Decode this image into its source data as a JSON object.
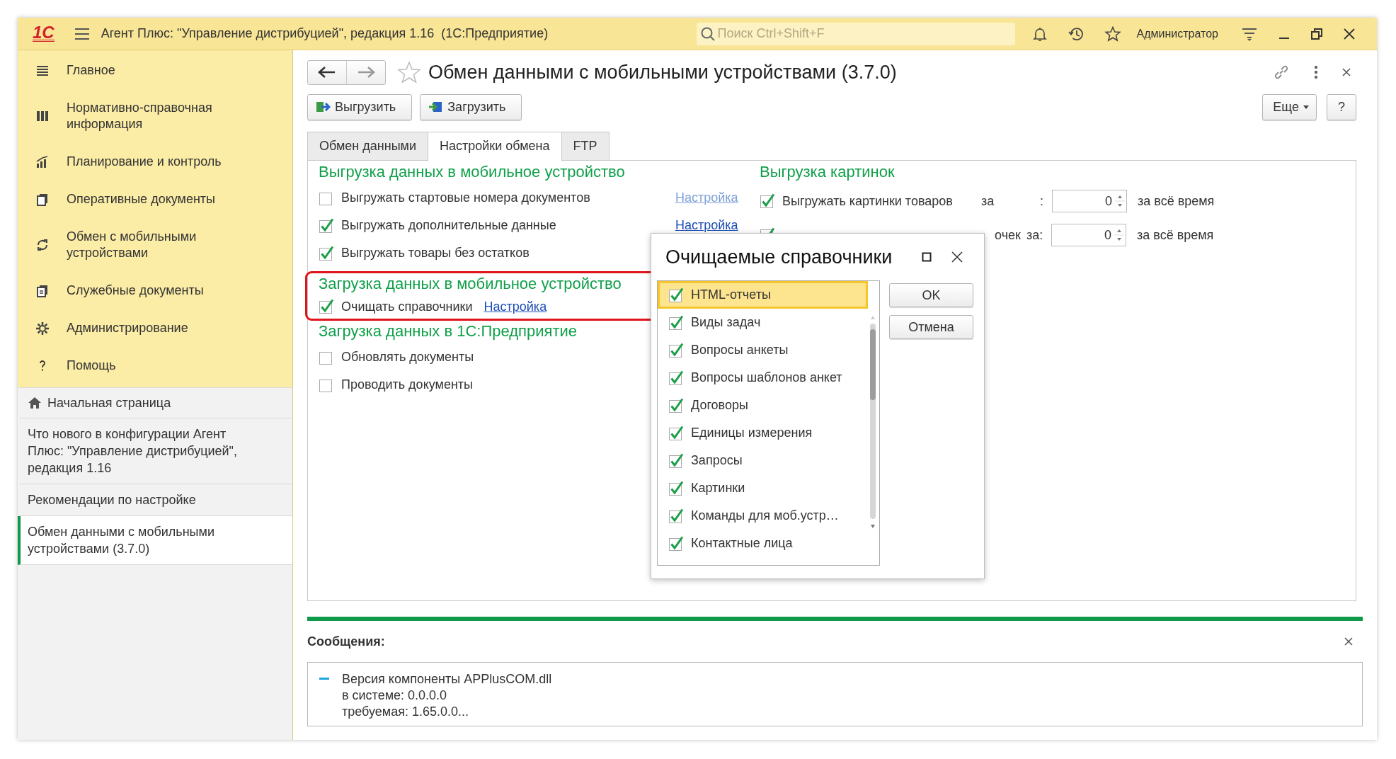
{
  "window": {
    "logo": "1С",
    "title": "Агент Плюс: \"Управление дистрибуцией\", редакция 1.16  (1С:Предприятие)",
    "search": {
      "placeholder": "Поиск Ctrl+Shift+F"
    },
    "user": "Администратор"
  },
  "sidebar": {
    "sections": [
      {
        "label": "Главное"
      },
      {
        "label": "Нормативно-справочная информация"
      },
      {
        "label": "Планирование и контроль"
      },
      {
        "label": "Оперативные документы"
      },
      {
        "label": "Обмен с мобильными устройствами"
      },
      {
        "label": "Служебные документы"
      },
      {
        "label": "Администрирование"
      },
      {
        "label": "Помощь"
      }
    ],
    "history": [
      {
        "label": "Начальная страница",
        "selected": false
      },
      {
        "label": "Что нового в конфигурации Агент Плюс: \"Управление дистрибуцией\", редакция 1.16",
        "selected": false
      },
      {
        "label": "Рекомендации по настройке",
        "selected": false
      },
      {
        "label": "Обмен данными с мобильными устройствами (3.7.0)",
        "selected": true
      }
    ]
  },
  "form": {
    "title": "Обмен данными с мобильными устройствами (3.7.0)",
    "buttons": [
      {
        "label": "Выгрузить"
      },
      {
        "label": "Загрузить"
      }
    ],
    "more": "Еще",
    "help": "?",
    "tabs": [
      {
        "label": "Обмен данными",
        "selected": false
      },
      {
        "label": "Настройки обмена",
        "selected": true
      },
      {
        "label": "FTP",
        "selected": false
      }
    ],
    "groups": [
      {
        "title": "Выгрузка данных в мобильное устройство",
        "highlighted": false,
        "options": [
          {
            "label": "Выгружать стартовые номера документов",
            "checked": false,
            "link": {
              "label": "Настройка",
              "disabled": true
            }
          },
          {
            "label": "Выгружать дополнительные данные",
            "checked": true,
            "link": {
              "label": "Настройка",
              "disabled": false
            }
          },
          {
            "label": "Выгружать товары без остатков",
            "checked": true
          }
        ]
      },
      {
        "title": "Загрузка данных в мобильное устройство",
        "highlighted": true,
        "options": [
          {
            "label": "Очищать справочники",
            "checked": true,
            "link": {
              "label": "Настройка",
              "disabled": false,
              "kind": "inline"
            }
          }
        ]
      },
      {
        "title": "Загрузка данных в 1С:Предприятие",
        "highlighted": false,
        "options": [
          {
            "label": "Обновлять документы",
            "checked": false
          },
          {
            "label": "Проводить документы",
            "checked": false
          }
        ]
      }
    ],
    "pictures": {
      "title": "Выгрузка картинок",
      "rows": [
        {
          "label": "Выгружать картинки товаров",
          "checked": true,
          "for_label": "за",
          "colon": ":",
          "value": "0",
          "period": "за всё время"
        },
        {
          "label": "очек",
          "checked": true,
          "for_label": "за:",
          "value": "0",
          "period": "за всё время"
        }
      ]
    }
  },
  "dialog": {
    "title": "Очищаемые справочники",
    "items": [
      {
        "label": "HTML-отчеты",
        "checked": true,
        "selected": true
      },
      {
        "label": "Виды задач",
        "checked": true,
        "selected": false
      },
      {
        "label": "Вопросы анкеты",
        "checked": true,
        "selected": false
      },
      {
        "label": "Вопросы шаблонов анкет",
        "checked": true,
        "selected": false
      },
      {
        "label": "Договоры",
        "checked": true,
        "selected": false
      },
      {
        "label": "Единицы измерения",
        "checked": true,
        "selected": false
      },
      {
        "label": "Запросы",
        "checked": true,
        "selected": false
      },
      {
        "label": "Картинки",
        "checked": true,
        "selected": false
      },
      {
        "label": "Команды для моб.устр…",
        "checked": true,
        "selected": false
      },
      {
        "label": "Контактные лица",
        "checked": true,
        "selected": false
      }
    ],
    "buttons": [
      "OK",
      "Отмена"
    ]
  },
  "messages": {
    "title": "Сообщения:",
    "items": [
      {
        "text": "Версия компоненты APPlusCOM.dll\nв системе: 0.0.0.0\nтребуемая: 1.65.0.0..."
      }
    ]
  }
}
